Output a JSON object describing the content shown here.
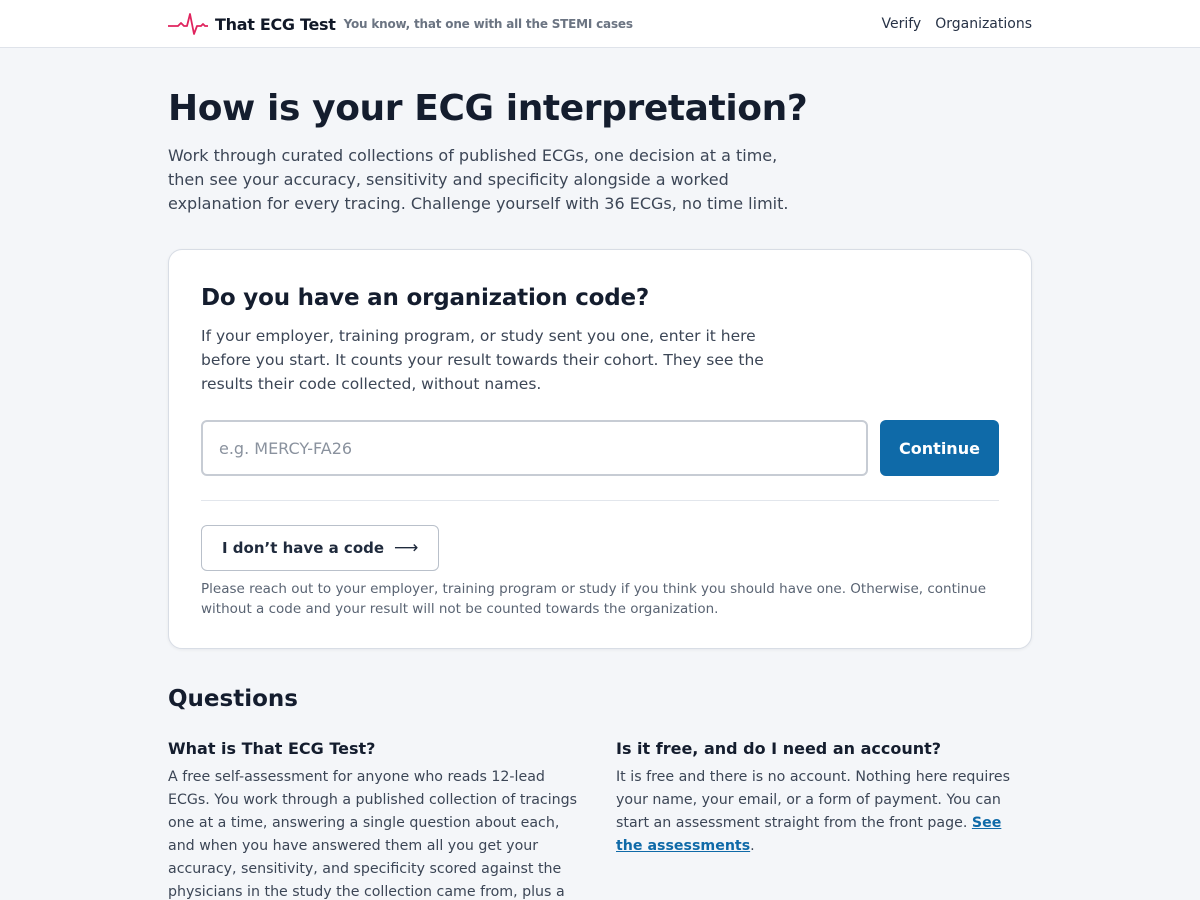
{
  "header": {
    "brand_name": "That ECG Test",
    "tagline": "You know, that one with all the STEMI cases",
    "nav": [
      {
        "label": "Verify"
      },
      {
        "label": "Organizations"
      }
    ],
    "logo_color": "#e0245e"
  },
  "hero": {
    "title": "How is your ECG interpretation?",
    "description": "Work through curated collections of published ECGs, one decision at a time, then see your accuracy, sensitivity and specificity alongside a worked explanation for every tracing. Challenge yourself with 36 ECGs, no time limit."
  },
  "org_card": {
    "title": "Do you have an organization code?",
    "description": "If your employer, training program, or study sent you one, enter it here before you start. It counts your result towards their cohort. They see the results their code collected, without names.",
    "input_placeholder": "e.g. MERCY-FA26",
    "input_value": "",
    "continue_label": "Continue",
    "no_code_label": "I don’t have a code",
    "no_code_icon": "arrow-right-icon",
    "note": "Please reach out to your employer, training program or study if you think you should have one. Otherwise, continue without a code and your result will not be counted towards the organization.",
    "accent_color": "#0f6aa8"
  },
  "questions": {
    "title": "Questions",
    "items": [
      {
        "question": "What is That ECG Test?",
        "answer": "A free self-assessment for anyone who reads 12-lead ECGs. You work through a published collection of tracings one at a time, answering a single question about each, and when you have answered them all you get your accuracy, sensitivity, and specificity scored against the physicians in the study the collection came from, plus a worked explanation for every ECG."
      },
      {
        "question": "Is it free, and do I need an account?",
        "answer": "It is free and there is no account. Nothing here requires your name, your email, or a form of payment. You can start an assessment straight from the front page.",
        "link_label": "See the assessments",
        "after_link": "."
      }
    ]
  }
}
